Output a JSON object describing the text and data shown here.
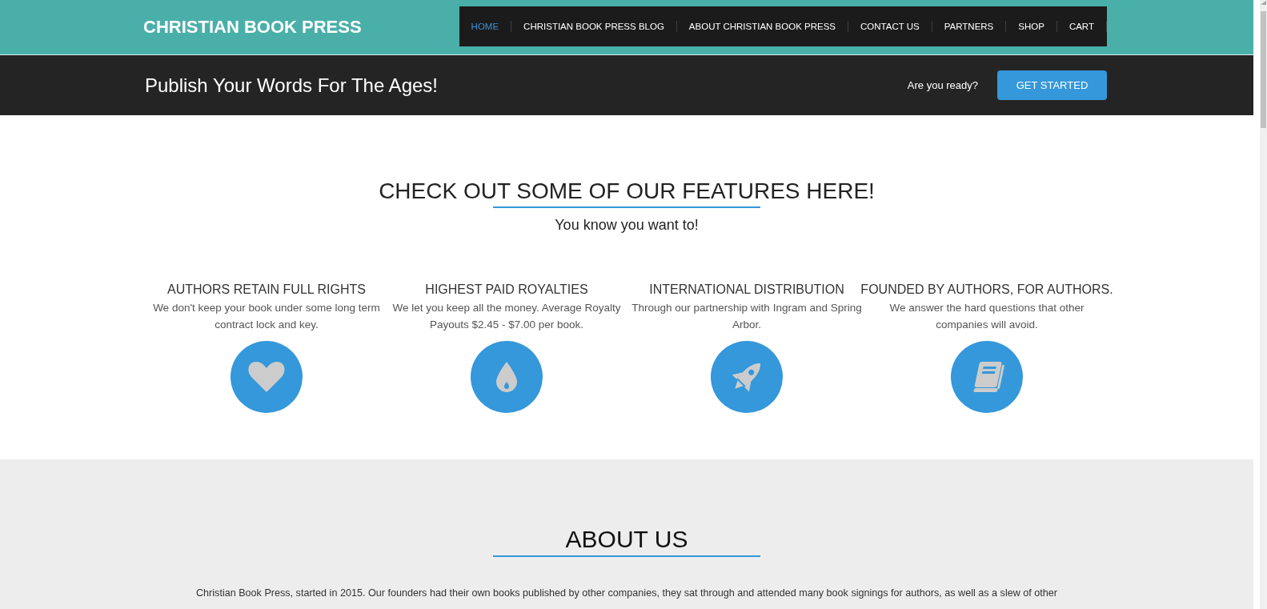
{
  "header": {
    "logo": "CHRISTIAN BOOK PRESS",
    "nav": [
      {
        "label": "HOME",
        "selected": true
      },
      {
        "label": "CHRISTIAN BOOK PRESS BLOG",
        "selected": false
      },
      {
        "label": "ABOUT CHRISTIAN BOOK PRESS",
        "selected": false
      },
      {
        "label": "CONTACT US",
        "selected": false
      },
      {
        "label": "PARTNERS",
        "selected": false
      },
      {
        "label": "SHOP",
        "selected": false
      },
      {
        "label": "CART",
        "selected": false
      }
    ]
  },
  "banner": {
    "tagline": "Publish Your Words For The Ages!",
    "prompt": "Are you ready?",
    "button": "GET STARTED"
  },
  "features": {
    "title": "CHECK OUT SOME OF OUR FEATURES HERE!",
    "subtitle": "You know you want to!",
    "items": [
      {
        "kind": "heart",
        "title": "AUTHORS RETAIN FULL RIGHTS",
        "text": "We don't keep your book under some long term contract lock and key."
      },
      {
        "kind": "drop",
        "title": "HIGHEST PAID ROYALTIES",
        "text": "We let you keep all the money. Average Royalty Payouts $2.45 - $7.00 per book."
      },
      {
        "kind": "rocket",
        "title": "INTERNATIONAL DISTRIBUTION",
        "text": "Through our partnership with Ingram and Spring Arbor."
      },
      {
        "kind": "book",
        "title": "FOUNDED BY AUTHORS, FOR AUTHORS.",
        "text": "We answer the hard questions that other companies will avoid."
      }
    ]
  },
  "about": {
    "title": "ABOUT US",
    "text": "Christian Book Press, started in 2015. Our founders had their own books published by other companies, they sat through and attended many book signings for authors, as well as a slew of other"
  }
}
